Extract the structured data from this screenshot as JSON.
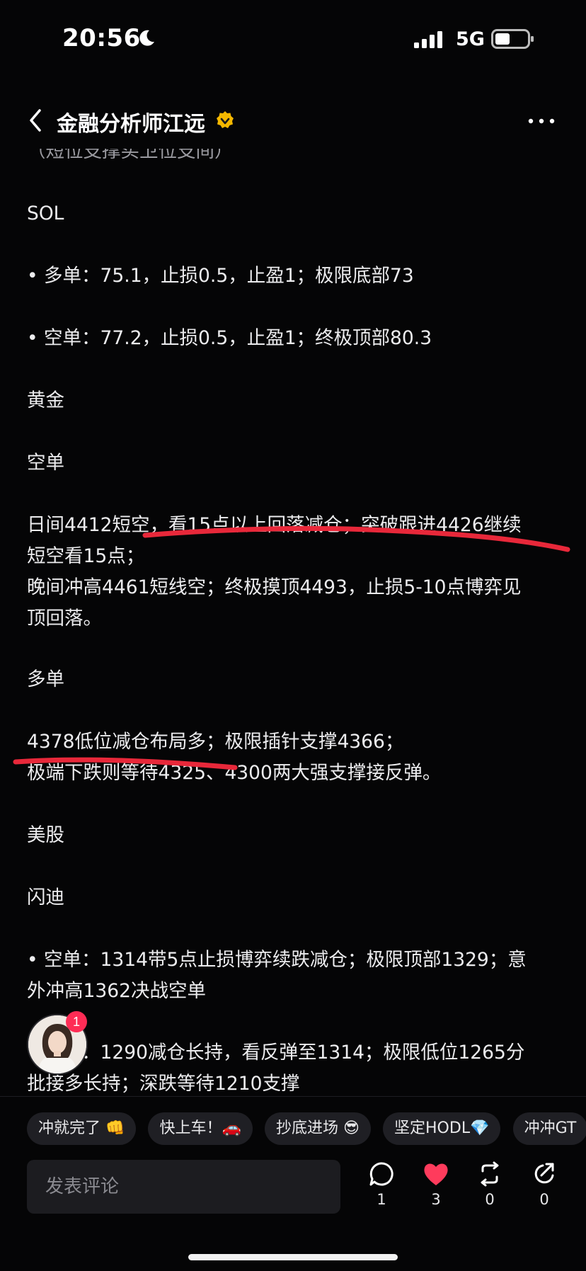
{
  "status_bar": {
    "time": "20:56",
    "network": "5G"
  },
  "nav": {
    "title": "金融分析师江远"
  },
  "article": {
    "clipped_line": "（短位支撑买卫位支间）",
    "lines": [
      "SOL",
      "• 多单：75.1，止损0.5，止盈1；极限底部73",
      "• 空单：77.2，止损0.5，止盈1；终极顶部80.3",
      "黄金",
      "空单",
      "日间4412短空，看15点以上回落减仓；突破跟进4426继续",
      "短空看15点；",
      "晚间冲高4461短线空；终极摸顶4493，止损5-10点博弈见",
      "顶回落。",
      "多单",
      "4378低位减仓布局多；极限插针支撑4366；",
      "极端下跌则等待4325、4300两大强支撑接反弹。",
      "美股",
      "闪迪",
      "• 空单：1314带5点止损博弈续跌减仓；极限顶部1329；意",
      "外冲高1362决战空单",
      "• 多单：1290减仓长持，看反弹至1314；极限低位1265分",
      "批接多长持；深跌等待1210支撑"
    ]
  },
  "avatar": {
    "badge_count": "1"
  },
  "quick_replies": [
    "冲就完了 👊",
    "快上车！🚗",
    "抄底进场 😎",
    "坚定HODL💎",
    "冲冲GT"
  ],
  "comment_bar": {
    "placeholder": "发表评论",
    "actions": [
      {
        "icon": "comment-icon",
        "count": "1"
      },
      {
        "icon": "heart-icon",
        "count": "3",
        "color": "#ff3b5c"
      },
      {
        "icon": "repost-icon",
        "count": "0"
      },
      {
        "icon": "share-icon",
        "count": "0"
      }
    ]
  },
  "colors": {
    "background": "#050506",
    "accent_red": "#ff3b5c",
    "verified": "#f5b800",
    "marker_red": "#e8283a"
  }
}
